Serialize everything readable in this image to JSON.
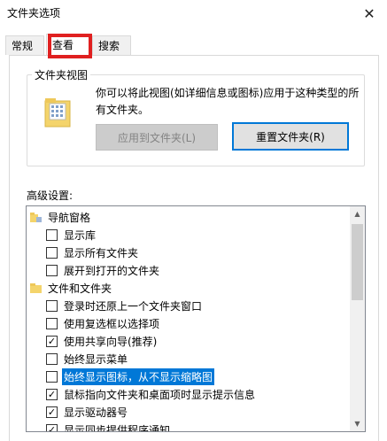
{
  "window": {
    "title": "文件夹选项"
  },
  "tabs": [
    {
      "label": "常规"
    },
    {
      "label": "查看"
    },
    {
      "label": "搜索"
    }
  ],
  "highlight_color": "#e02020",
  "folder_view": {
    "group_label": "文件夹视图",
    "description": "你可以将此视图(如详细信息或图标)应用于这种类型的所有文件夹。",
    "apply_button": "应用到文件夹(L)",
    "reset_button": "重置文件夹(R)",
    "icon": "folder-grid-icon"
  },
  "advanced": {
    "label": "高级设置:",
    "items": [
      {
        "type": "header",
        "label": "导航窗格",
        "icon": "nav-folder-icon"
      },
      {
        "type": "checkbox",
        "label": "显示库",
        "checked": false
      },
      {
        "type": "checkbox",
        "label": "显示所有文件夹",
        "checked": false
      },
      {
        "type": "checkbox",
        "label": "展开到打开的文件夹",
        "checked": false
      },
      {
        "type": "header",
        "label": "文件和文件夹",
        "icon": "folder-icon"
      },
      {
        "type": "checkbox",
        "label": "登录时还原上一个文件夹窗口",
        "checked": false
      },
      {
        "type": "checkbox",
        "label": "使用复选框以选择项",
        "checked": false
      },
      {
        "type": "checkbox",
        "label": "使用共享向导(推荐)",
        "checked": true
      },
      {
        "type": "checkbox",
        "label": "始终显示菜单",
        "checked": false
      },
      {
        "type": "checkbox",
        "label": "始终显示图标，从不显示缩略图",
        "checked": false,
        "selected": true
      },
      {
        "type": "checkbox",
        "label": "鼠标指向文件夹和桌面项时显示提示信息",
        "checked": true
      },
      {
        "type": "checkbox",
        "label": "显示驱动器号",
        "checked": true
      },
      {
        "type": "checkbox",
        "label": "显示同步提供程序通知",
        "checked": true
      }
    ]
  }
}
